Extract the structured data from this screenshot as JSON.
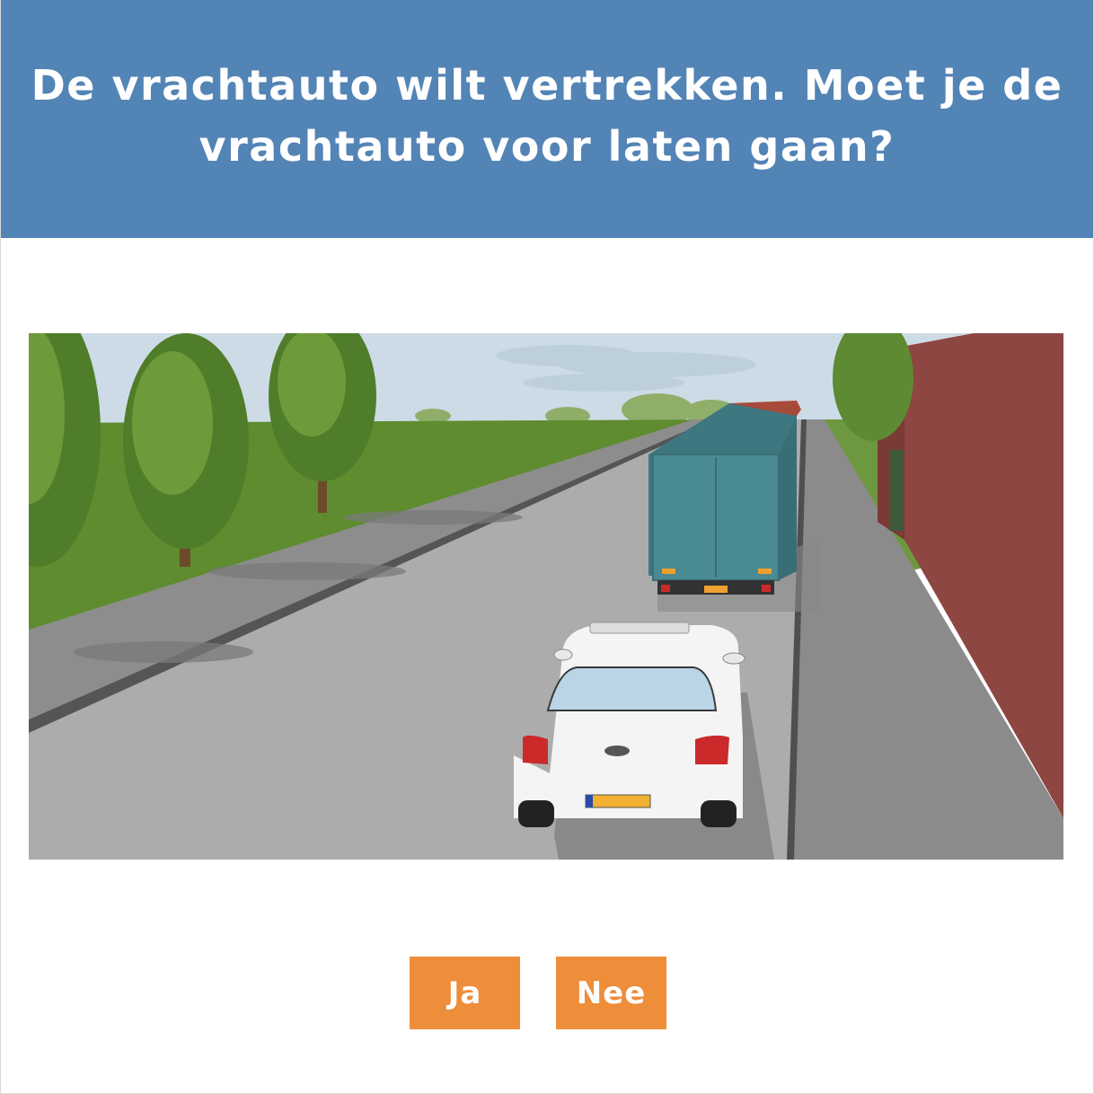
{
  "question": {
    "text": "De vrachtauto wilt vertrekken. Moet je de vrachtauto voor laten gaan?",
    "background_color": "#5384b6"
  },
  "answers": [
    {
      "label": "Ja"
    },
    {
      "label": "Nee"
    }
  ],
  "button_color": "#ee8d3a",
  "scene": {
    "sky_color": "#cddbe6",
    "grass_color": "#5e8c2e",
    "road_color": "#acacac",
    "building_color": "#8e4642",
    "truck_color": "#4a8a93",
    "car_color": "#ffffff"
  }
}
